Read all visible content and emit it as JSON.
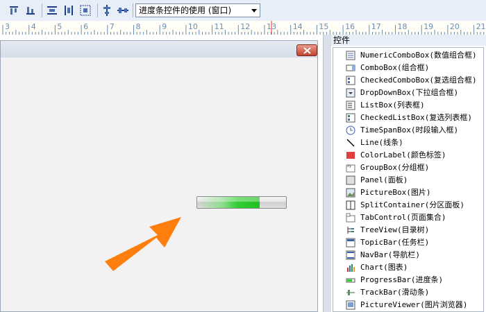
{
  "toolbar": {
    "form_select_value": "进度条控件的使用 (窗口)",
    "icons": [
      "align-top-icon",
      "align-bottom-icon",
      "space-horizontal-icon",
      "space-vertical-icon",
      "center-icon",
      "center-vertical-icon",
      "center-horizontal-icon"
    ]
  },
  "ruler": {
    "labels": [
      "3",
      "4",
      "5",
      "6",
      "7",
      "8",
      "9",
      "10",
      "11",
      "12",
      "13",
      "14",
      "15",
      "16",
      "17",
      "18",
      "19",
      "20",
      "21"
    ]
  },
  "form": {
    "close_icon": "close-icon"
  },
  "progress_bar": {
    "value_fraction": 0.7
  },
  "annotation": {
    "arrow_color": "#ff7f0e"
  },
  "toolbox": {
    "title": "控件",
    "items": [
      {
        "label": "NumericComboBox(数值组合框)",
        "icon": "numeric-combobox-icon"
      },
      {
        "label": "ComboBox(组合框)",
        "icon": "combobox-icon"
      },
      {
        "label": "CheckedComboBox(复选组合框)",
        "icon": "checked-combobox-icon"
      },
      {
        "label": "DropDownBox(下拉组合框)",
        "icon": "dropdownbox-icon"
      },
      {
        "label": "ListBox(列表框)",
        "icon": "listbox-icon"
      },
      {
        "label": "CheckedListBox(复选列表框)",
        "icon": "checked-listbox-icon"
      },
      {
        "label": "TimeSpanBox(时段输入框)",
        "icon": "clock-icon"
      },
      {
        "label": "Line(线条)",
        "icon": "line-icon"
      },
      {
        "label": "ColorLabel(颜色标签)",
        "icon": "color-label-icon"
      },
      {
        "label": "GroupBox(分组框)",
        "icon": "groupbox-icon"
      },
      {
        "label": "Panel(面板)",
        "icon": "panel-icon"
      },
      {
        "label": "PictureBox(图片)",
        "icon": "picture-icon"
      },
      {
        "label": "SplitContainer(分区面板)",
        "icon": "split-container-icon"
      },
      {
        "label": "TabControl(页面集合)",
        "icon": "tab-control-icon"
      },
      {
        "label": "TreeView(目录树)",
        "icon": "treeview-icon"
      },
      {
        "label": "TopicBar(任务栏)",
        "icon": "topicbar-icon"
      },
      {
        "label": "NavBar(导航栏)",
        "icon": "navbar-icon"
      },
      {
        "label": "Chart(图表)",
        "icon": "chart-icon"
      },
      {
        "label": "ProgressBar(进度条)",
        "icon": "progressbar-icon"
      },
      {
        "label": "TrackBar(滑动条)",
        "icon": "trackbar-icon"
      },
      {
        "label": "PictureViewer(图片浏览器)",
        "icon": "picture-viewer-icon"
      }
    ]
  }
}
